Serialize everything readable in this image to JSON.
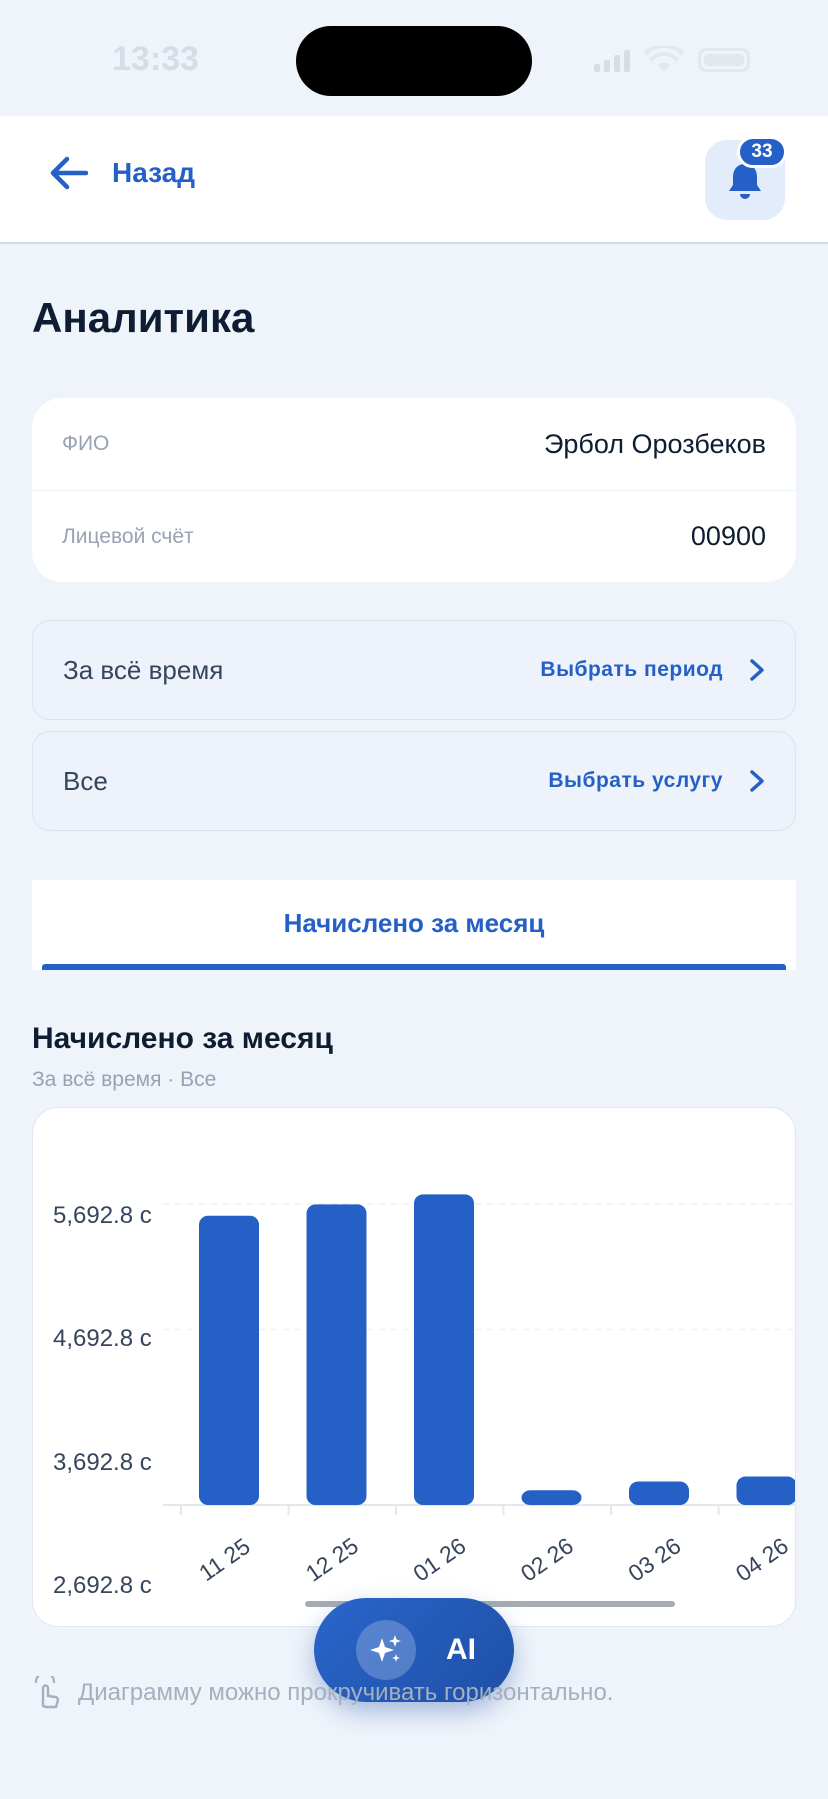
{
  "status_bar": {
    "time": "13:33"
  },
  "header": {
    "back_label": "Назад",
    "notification_count": "33",
    "colors": {
      "accent": "#2460c6",
      "badge": "#2460c6"
    }
  },
  "page": {
    "title": "Аналитика"
  },
  "account": {
    "rows": [
      {
        "label": "ФИО",
        "value": "Эрбол Орозбеков"
      },
      {
        "label": "Лицевой счёт",
        "value": "00900"
      }
    ]
  },
  "filters": {
    "period": {
      "value": "За всё время",
      "action": "Выбрать период"
    },
    "service": {
      "value": "Все",
      "action": "Выбрать услугу"
    }
  },
  "tabs": [
    {
      "label": "Начислено за месяц",
      "active": true
    }
  ],
  "section": {
    "title": "Начислено за месяц",
    "subtitle": "За всё время · Все"
  },
  "chart_data": {
    "type": "bar",
    "categories": [
      "11 25",
      "12 25",
      "01 26",
      "02 26",
      "03 26",
      "04 26"
    ],
    "values": [
      6000,
      6090,
      6170,
      3810,
      3880,
      3920
    ],
    "y_ticks": [
      {
        "value": 5692.8,
        "label": "5,692.8 с"
      },
      {
        "value": 4692.8,
        "label": "4,692.8 с"
      },
      {
        "value": 3692.8,
        "label": "3,692.8 с"
      },
      {
        "value": 2692.8,
        "label": "2,692.8 с"
      }
    ],
    "ylim": [
      3692.8,
      6500
    ],
    "grid": true,
    "bar_color": "#2460c6"
  },
  "ai_button": {
    "label": "AI"
  },
  "hint": {
    "text": "Диаграмму можно прокручивать горизонтально."
  }
}
